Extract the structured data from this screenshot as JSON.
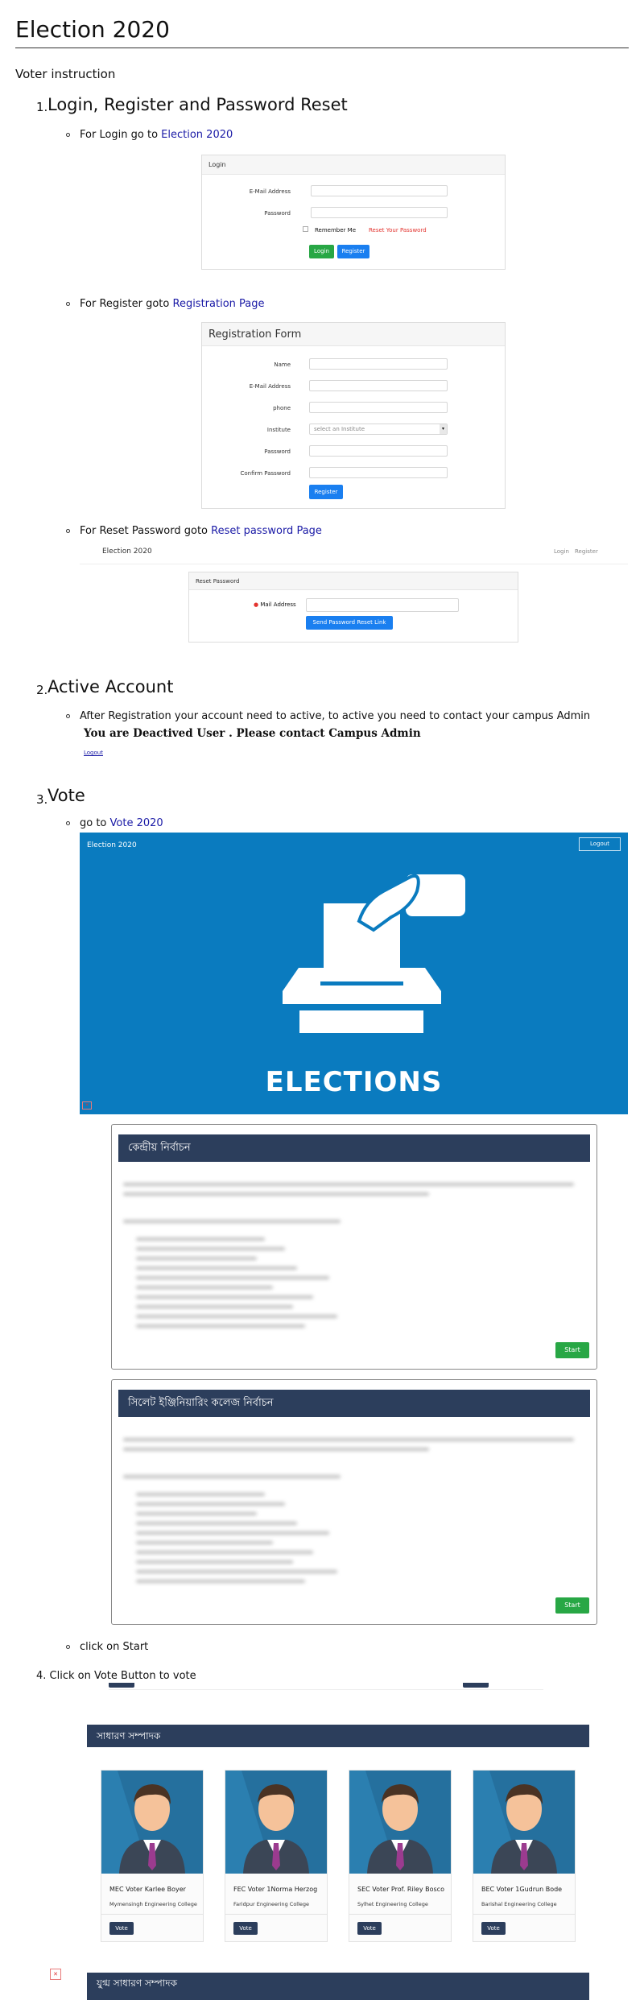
{
  "title": "Election 2020",
  "intro": "Voter instruction",
  "sections": {
    "s1": {
      "num": "1.",
      "heading": "Login, Register and Password Reset"
    },
    "s2": {
      "num": "2.",
      "heading": "Active Account"
    },
    "s3": {
      "num": "3.",
      "heading": "Vote"
    },
    "s4": {
      "text": "4. Click on Vote Button to vote"
    }
  },
  "login_item": {
    "prefix": "For Login go to ",
    "link": "Election 2020"
  },
  "register_item": {
    "prefix": "For Register goto ",
    "link": "Registration Page"
  },
  "reset_item": {
    "prefix": "For Reset Password goto ",
    "link": "Reset password Page"
  },
  "login_form": {
    "header": "Login",
    "email_label": "E-Mail Address",
    "password_label": "Password",
    "remember": "Remember Me",
    "forgot": "Reset Your Password",
    "login_btn": "Login",
    "register_btn": "Register"
  },
  "registration_form": {
    "header": "Registration Form",
    "name_label": "Name",
    "email_label": "E-Mail Address",
    "phone_label": "phone",
    "institute_label": "Institute",
    "institute_placeholder": "select an Institute",
    "password_label": "Password",
    "confirm_label": "Confirm Password",
    "register_btn": "Register"
  },
  "reset_page": {
    "brand": "Election 2020",
    "nav_login": "Login",
    "nav_register": "Register",
    "header": "Reset Password",
    "email_label": "Mail Address",
    "send_btn": "Send Password Reset Link"
  },
  "active_item": "After Registration your account need to active, to active you need to contact your campus Admin",
  "deactivated": {
    "message": "You are Deactived User . Please contact Campus Admin",
    "logout": "Logout"
  },
  "vote_item": {
    "prefix": "go to ",
    "link": "Vote 2020"
  },
  "banner": {
    "brand": "Election 2020",
    "logout": "Logout",
    "caption": "ELECTIONS"
  },
  "elections": [
    {
      "title": "কেন্দ্রীয় নির্বাচন",
      "start": "Start"
    },
    {
      "title": "সিলেট ইঞ্জিনিয়ারিং কলেজ নির্বাচন",
      "start": "Start"
    }
  ],
  "click_start": "click on Start",
  "vote_section": {
    "title": "সাধারণ সম্পাদক",
    "next_title": "যুগ্ম সাধারণ সম্পাদক",
    "vote_label": "Vote",
    "candidates": [
      {
        "name": "MEC Voter Karlee Boyer",
        "college": "Mymensingh Engineering College"
      },
      {
        "name": "FEC Voter 1Norma Herzog",
        "college": "Faridpur Engineering College"
      },
      {
        "name": "SEC Voter Prof. Riley Bosco",
        "college": "Sylhet Engineering College"
      },
      {
        "name": "BEC Voter 1Gudrun Bode",
        "college": "Barishal Engineering College"
      }
    ]
  },
  "colors": {
    "accent": "#2c3e5c",
    "banner": "#0a7bbf",
    "start": "#28a745",
    "link": "#1a1aa6"
  }
}
